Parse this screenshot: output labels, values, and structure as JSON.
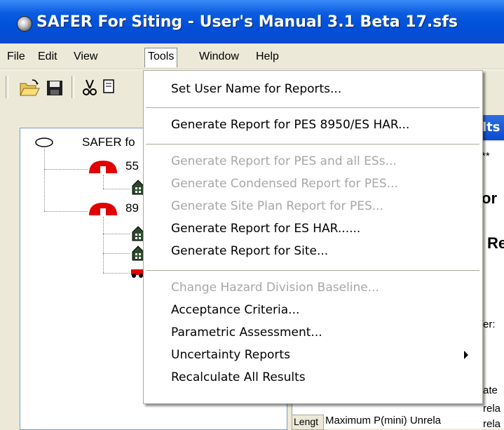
{
  "window": {
    "title": "SAFER For Siting - User's Manual 3.1 Beta 17.sfs"
  },
  "menubar": {
    "items": [
      "File",
      "Edit",
      "View",
      "Tools",
      "Window",
      "Help"
    ],
    "active": "Tools"
  },
  "toolbar": {
    "icons": [
      "open-folder-icon",
      "save-disk-icon",
      "cut-scissors-icon",
      "copy-icon"
    ]
  },
  "tree": {
    "root_label": "SAFER fo",
    "items": [
      {
        "label": "55",
        "icon": "pes-dome-icon"
      },
      {
        "label": "",
        "icon": "es-building-icon"
      },
      {
        "label": "89",
        "icon": "pes-dome-icon"
      },
      {
        "label": "",
        "icon": "es-building-icon"
      },
      {
        "label": "",
        "icon": "es-building-icon"
      },
      {
        "label": "",
        "icon": "es-vehicle-icon"
      }
    ]
  },
  "results_panel": {
    "header_partial": "lts",
    "stars": "**",
    "line_or": "or",
    "line_re": "Re",
    "line_er": "er:",
    "line_ate": "ate",
    "line_rela": "rela",
    "line_rela2": "rela",
    "bottom_label": "Lengt",
    "bottom_value": "Maximum P(mini) Unrela"
  },
  "tools_menu": {
    "items": [
      {
        "label": "Set User Name for Reports...",
        "enabled": true
      },
      {
        "separator": true
      },
      {
        "label": "Generate Report for PES 8950/ES HAR...",
        "enabled": true
      },
      {
        "separator": true
      },
      {
        "label": "Generate Report for PES and all ESs...",
        "enabled": false
      },
      {
        "label": "Generate Condensed Report for PES...",
        "enabled": false
      },
      {
        "label": "Generate Site Plan Report for PES...",
        "enabled": false
      },
      {
        "label": "Generate Report for ES HAR......",
        "enabled": true
      },
      {
        "label": "Generate Report for Site...",
        "enabled": true
      },
      {
        "separator": true
      },
      {
        "label": "Change Hazard Division Baseline...",
        "enabled": false
      },
      {
        "label": "Acceptance Criteria...",
        "enabled": true
      },
      {
        "label": "Parametric Assessment...",
        "enabled": true
      },
      {
        "label": "Uncertainty Reports",
        "enabled": true,
        "submenu": true
      },
      {
        "label": "Recalculate All Results",
        "enabled": true
      }
    ]
  },
  "colors": {
    "titlebar": "#0050d8",
    "menu_bg": "#ffffff",
    "disabled_text": "#a7a6aa",
    "window_bg": "#ece9d8",
    "pes_red": "#e00000"
  }
}
